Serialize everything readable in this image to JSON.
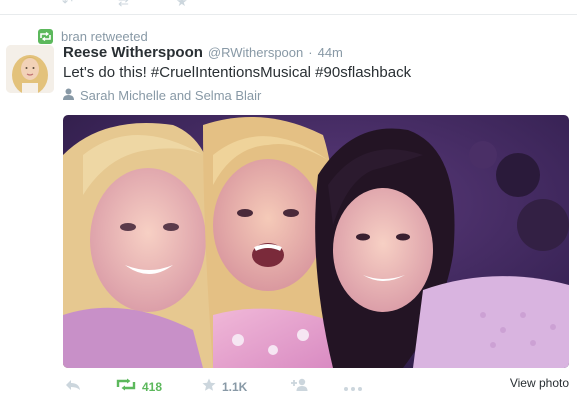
{
  "retweet_context": {
    "text": "bran retweeted"
  },
  "tweet": {
    "fullname": "Reese Witherspoon",
    "username": "@RWitherspoon",
    "separator": "·",
    "time": "44m",
    "text_prefix": "Let's do this! ",
    "hashtags": [
      "#CruelIntentionsMusical",
      "#90sflashback"
    ],
    "tagged_people": "Sarah Michelle and Selma Blair"
  },
  "actions": {
    "retweet_count": "418",
    "favorite_count": "1.1K",
    "view_photo_label": "View photo"
  },
  "icons": {
    "retweet_badge": "retweet-icon",
    "tag": "person-icon",
    "reply": "reply-icon",
    "retweet": "retweet-icon",
    "favorite": "star-icon",
    "follow": "add-user-icon",
    "more": "more-icon"
  },
  "colors": {
    "retweet_green": "#5cb85c",
    "muted_text": "#8899a6",
    "primary_text": "#292f33"
  }
}
